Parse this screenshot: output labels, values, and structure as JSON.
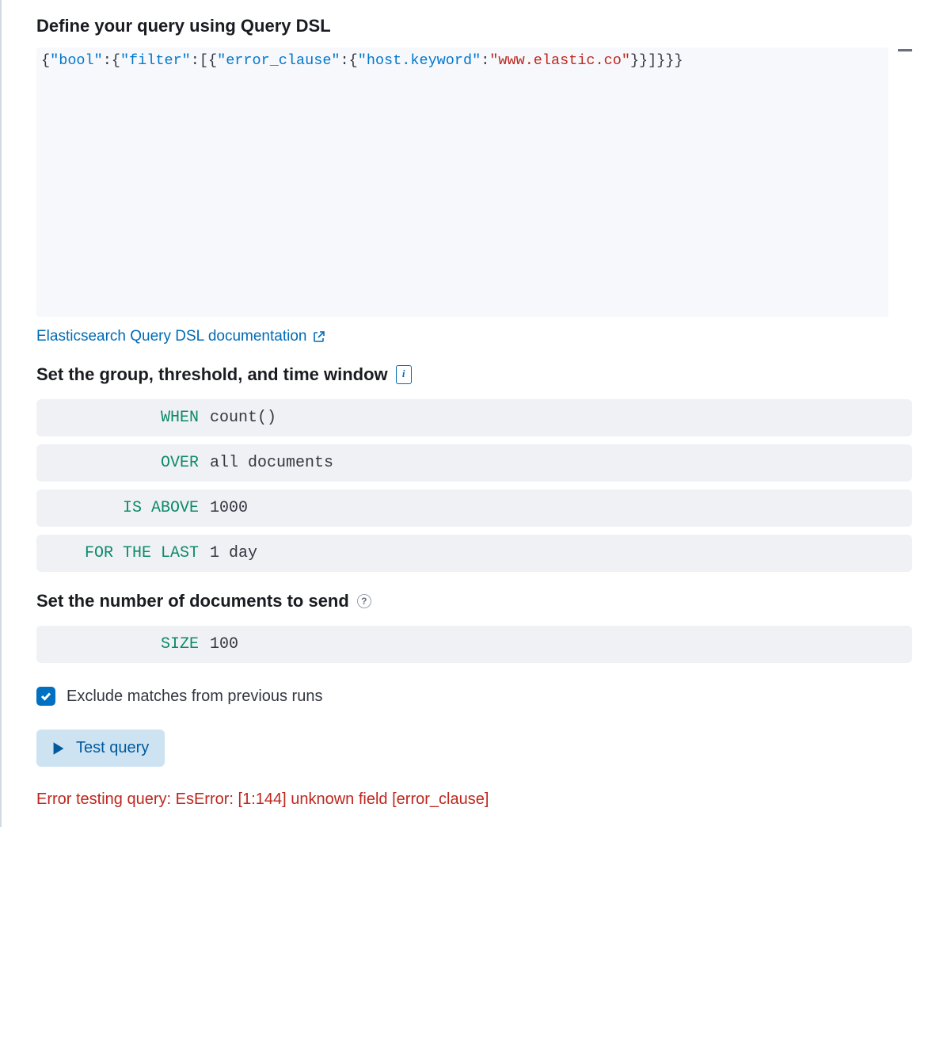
{
  "query_section": {
    "heading": "Define your query using Query DSL",
    "doc_link_text": "Elasticsearch Query DSL documentation",
    "json_tokens": {
      "k_bool": "\"bool\"",
      "k_filter": "\"filter\"",
      "k_error_clause": "\"error_clause\"",
      "k_host_keyword": "\"host.keyword\"",
      "v_host": "\"www.elastic.co\""
    }
  },
  "threshold_section": {
    "heading": "Set the group, threshold, and time window",
    "rows": {
      "when": {
        "label": "WHEN",
        "value": "count()"
      },
      "over": {
        "label": "OVER",
        "value": "all documents"
      },
      "isabove": {
        "label": "IS ABOVE",
        "value": "1000"
      },
      "forlast": {
        "label": "FOR THE LAST",
        "value": "1 day"
      }
    }
  },
  "docs_section": {
    "heading": "Set the number of documents to send",
    "size": {
      "label": "SIZE",
      "value": "100"
    }
  },
  "exclude_checkbox": {
    "checked": true,
    "label": "Exclude matches from previous runs"
  },
  "test_button": {
    "label": "Test query"
  },
  "error": {
    "message": "Error testing query: EsError: [1:144] unknown field [error_clause]"
  }
}
